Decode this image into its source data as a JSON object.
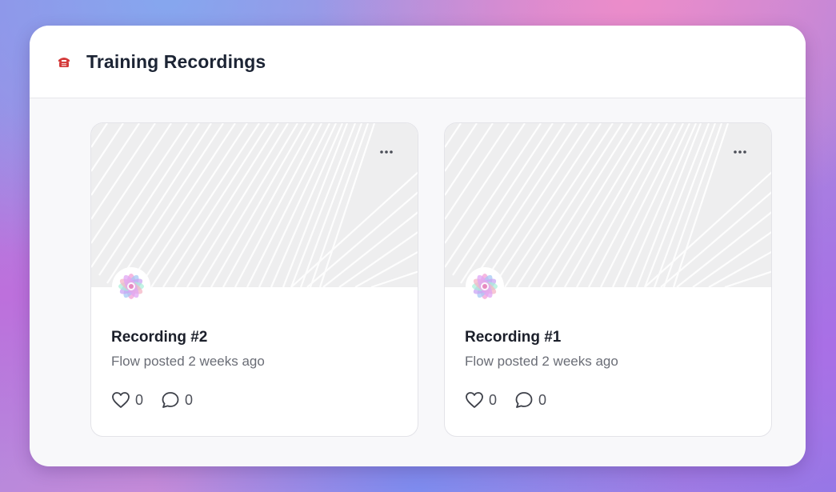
{
  "header": {
    "title": "Training Recordings",
    "icon": "telephone-icon"
  },
  "colors": {
    "header_icon": "#d43a3a",
    "title": "#1c2434",
    "card_title": "#1b1f2a",
    "meta": "#6a6d76"
  },
  "recordings": [
    {
      "title": "Recording #2",
      "meta": "Flow posted 2 weeks ago",
      "likes": "0",
      "comments": "0"
    },
    {
      "title": "Recording #1",
      "meta": "Flow posted 2 weeks ago",
      "likes": "0",
      "comments": "0"
    }
  ],
  "icons": {
    "more": "more-horizontal-icon",
    "like": "heart-icon",
    "comment": "comment-bubble-icon",
    "avatar": "flower-avatar-icon"
  }
}
